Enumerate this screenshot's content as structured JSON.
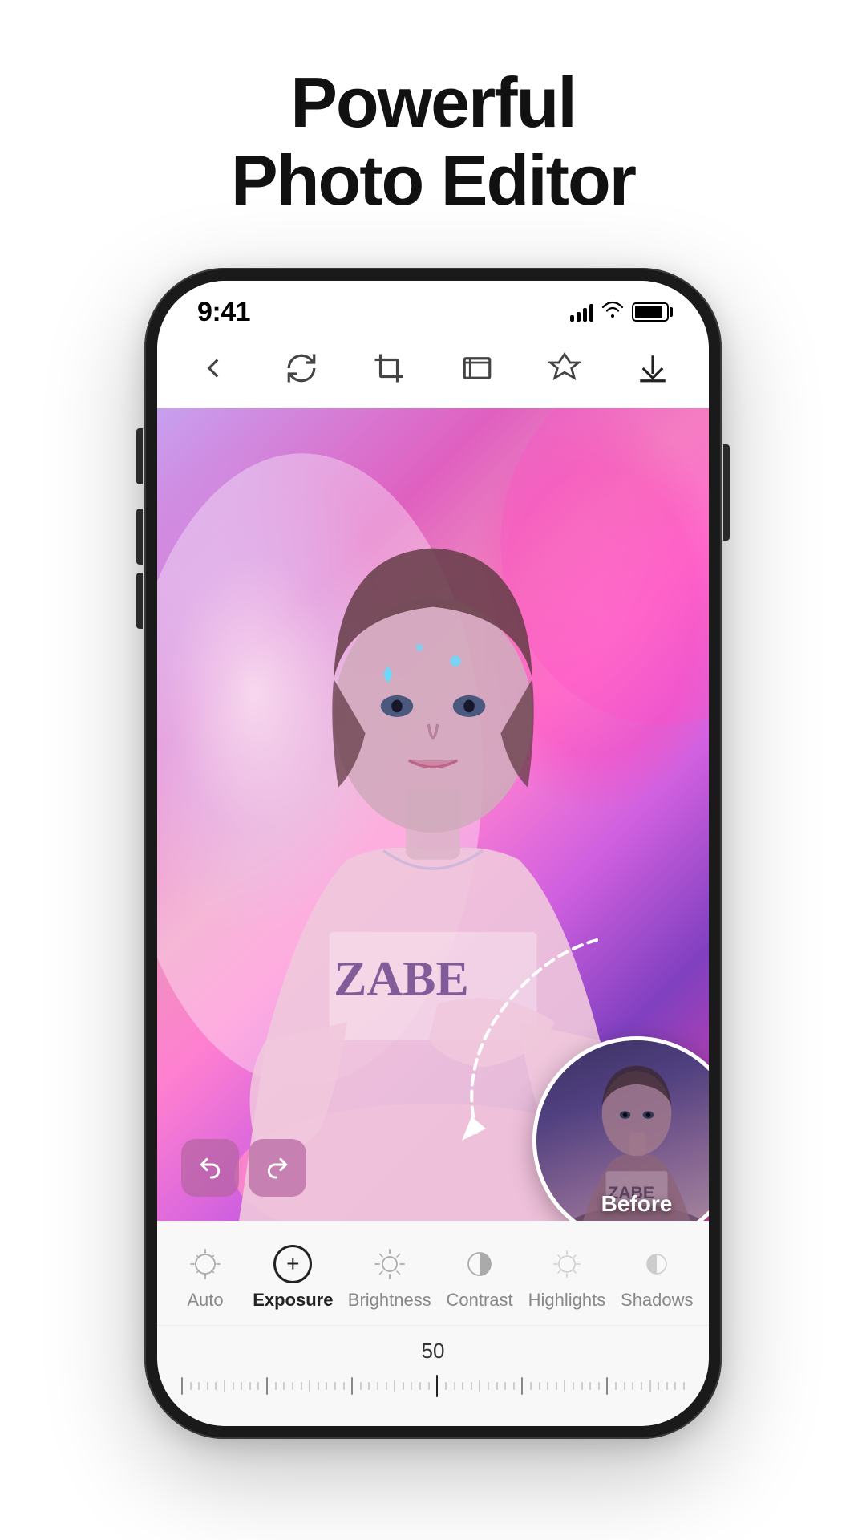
{
  "page": {
    "title_line1": "Powerful",
    "title_line2": "Photo Editor"
  },
  "status_bar": {
    "time": "9:41",
    "signal_label": "signal",
    "wifi_label": "wifi",
    "battery_label": "battery"
  },
  "toolbar": {
    "back_label": "back",
    "rotate_label": "rotate",
    "crop_label": "crop",
    "transform_label": "transform",
    "adjust_label": "adjust",
    "download_label": "download"
  },
  "before_label": "Before",
  "slider": {
    "value": "50"
  },
  "tools": [
    {
      "id": "auto",
      "label": "Auto",
      "active": false
    },
    {
      "id": "exposure",
      "label": "Exposure",
      "active": true
    },
    {
      "id": "brightness",
      "label": "Brightness",
      "active": false
    },
    {
      "id": "contrast",
      "label": "Contrast",
      "active": false
    },
    {
      "id": "highlights",
      "label": "Highlights",
      "active": false
    },
    {
      "id": "shadows",
      "label": "Shadows",
      "active": false
    }
  ]
}
